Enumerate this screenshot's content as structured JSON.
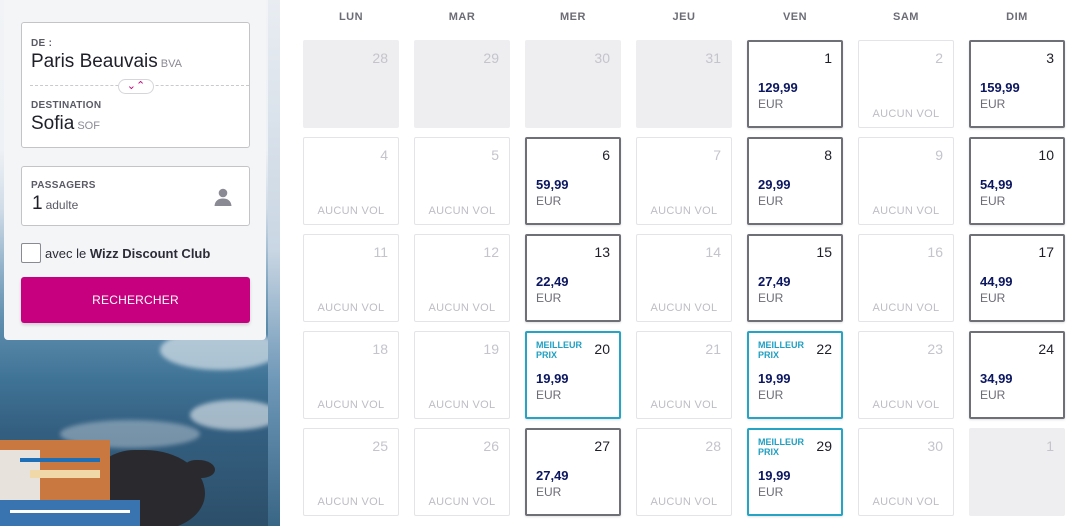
{
  "search": {
    "from_label": "DE :",
    "from_city": "Paris Beauvais",
    "from_code": "BVA",
    "to_label": "DESTINATION",
    "to_city": "Sofia",
    "to_code": "SOF",
    "swap_icon": "swap-chevrons-icon",
    "passengers_label": "PASSAGERS",
    "passengers_count": "1",
    "passengers_unit": "adulte",
    "passenger_icon": "user-icon",
    "club_prefix": "avec le",
    "club_name": "Wizz Discount Club",
    "club_checked": false,
    "search_button": "RECHERCHER"
  },
  "colors": {
    "brand": "#c6007e",
    "price": "#0b1660",
    "best_price": "#27a3c4",
    "available_border": "#6f6f78"
  },
  "calendar": {
    "weekdays": [
      "LUN",
      "MAR",
      "MER",
      "JEU",
      "VEN",
      "SAM",
      "DIM"
    ],
    "no_flight_label": "AUCUN VOL",
    "best_label": "MEILLEUR PRIX",
    "weeks": [
      [
        {
          "day": "28",
          "status": "past"
        },
        {
          "day": "29",
          "status": "past"
        },
        {
          "day": "30",
          "status": "past"
        },
        {
          "day": "31",
          "status": "past"
        },
        {
          "day": "1",
          "status": "available",
          "price": "129,99",
          "currency": "EUR"
        },
        {
          "day": "2",
          "status": "none"
        },
        {
          "day": "3",
          "status": "available",
          "price": "159,99",
          "currency": "EUR"
        }
      ],
      [
        {
          "day": "4",
          "status": "none"
        },
        {
          "day": "5",
          "status": "none"
        },
        {
          "day": "6",
          "status": "available",
          "price": "59,99",
          "currency": "EUR"
        },
        {
          "day": "7",
          "status": "none"
        },
        {
          "day": "8",
          "status": "available",
          "price": "29,99",
          "currency": "EUR"
        },
        {
          "day": "9",
          "status": "none"
        },
        {
          "day": "10",
          "status": "available",
          "price": "54,99",
          "currency": "EUR"
        }
      ],
      [
        {
          "day": "11",
          "status": "none"
        },
        {
          "day": "12",
          "status": "none"
        },
        {
          "day": "13",
          "status": "available",
          "price": "22,49",
          "currency": "EUR"
        },
        {
          "day": "14",
          "status": "none"
        },
        {
          "day": "15",
          "status": "available",
          "price": "27,49",
          "currency": "EUR"
        },
        {
          "day": "16",
          "status": "none"
        },
        {
          "day": "17",
          "status": "available",
          "price": "44,99",
          "currency": "EUR"
        }
      ],
      [
        {
          "day": "18",
          "status": "none"
        },
        {
          "day": "19",
          "status": "none"
        },
        {
          "day": "20",
          "status": "best",
          "price": "19,99",
          "currency": "EUR"
        },
        {
          "day": "21",
          "status": "none"
        },
        {
          "day": "22",
          "status": "best",
          "price": "19,99",
          "currency": "EUR"
        },
        {
          "day": "23",
          "status": "none"
        },
        {
          "day": "24",
          "status": "available",
          "price": "34,99",
          "currency": "EUR"
        }
      ],
      [
        {
          "day": "25",
          "status": "none"
        },
        {
          "day": "26",
          "status": "none"
        },
        {
          "day": "27",
          "status": "available",
          "price": "27,49",
          "currency": "EUR"
        },
        {
          "day": "28",
          "status": "none"
        },
        {
          "day": "29",
          "status": "best",
          "price": "19,99",
          "currency": "EUR"
        },
        {
          "day": "30",
          "status": "none"
        },
        {
          "day": "1",
          "status": "past"
        }
      ]
    ]
  }
}
